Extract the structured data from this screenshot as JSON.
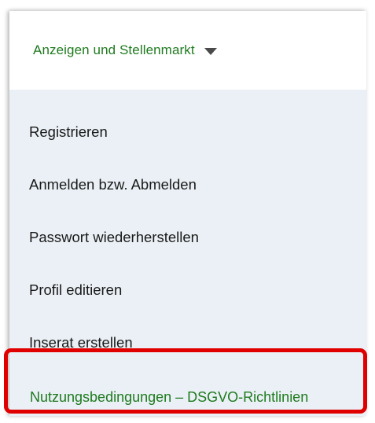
{
  "dropdown": {
    "title": "Anzeigen und Stellenmarkt",
    "caret_icon": "caret-down-icon"
  },
  "menu": {
    "items": [
      {
        "label": "Registrieren"
      },
      {
        "label": "Anmelden bzw. Abmelden"
      },
      {
        "label": "Passwort wiederherstellen"
      },
      {
        "label": "Profil editieren"
      },
      {
        "label": "Inserat erstellen"
      },
      {
        "label": "Nutzungsbedingungen – DSGVO-Richtlinien"
      }
    ]
  },
  "colors": {
    "accent_green": "#1e7a1e",
    "menu_background": "#eaf0f5",
    "highlight_border": "#e00000"
  }
}
